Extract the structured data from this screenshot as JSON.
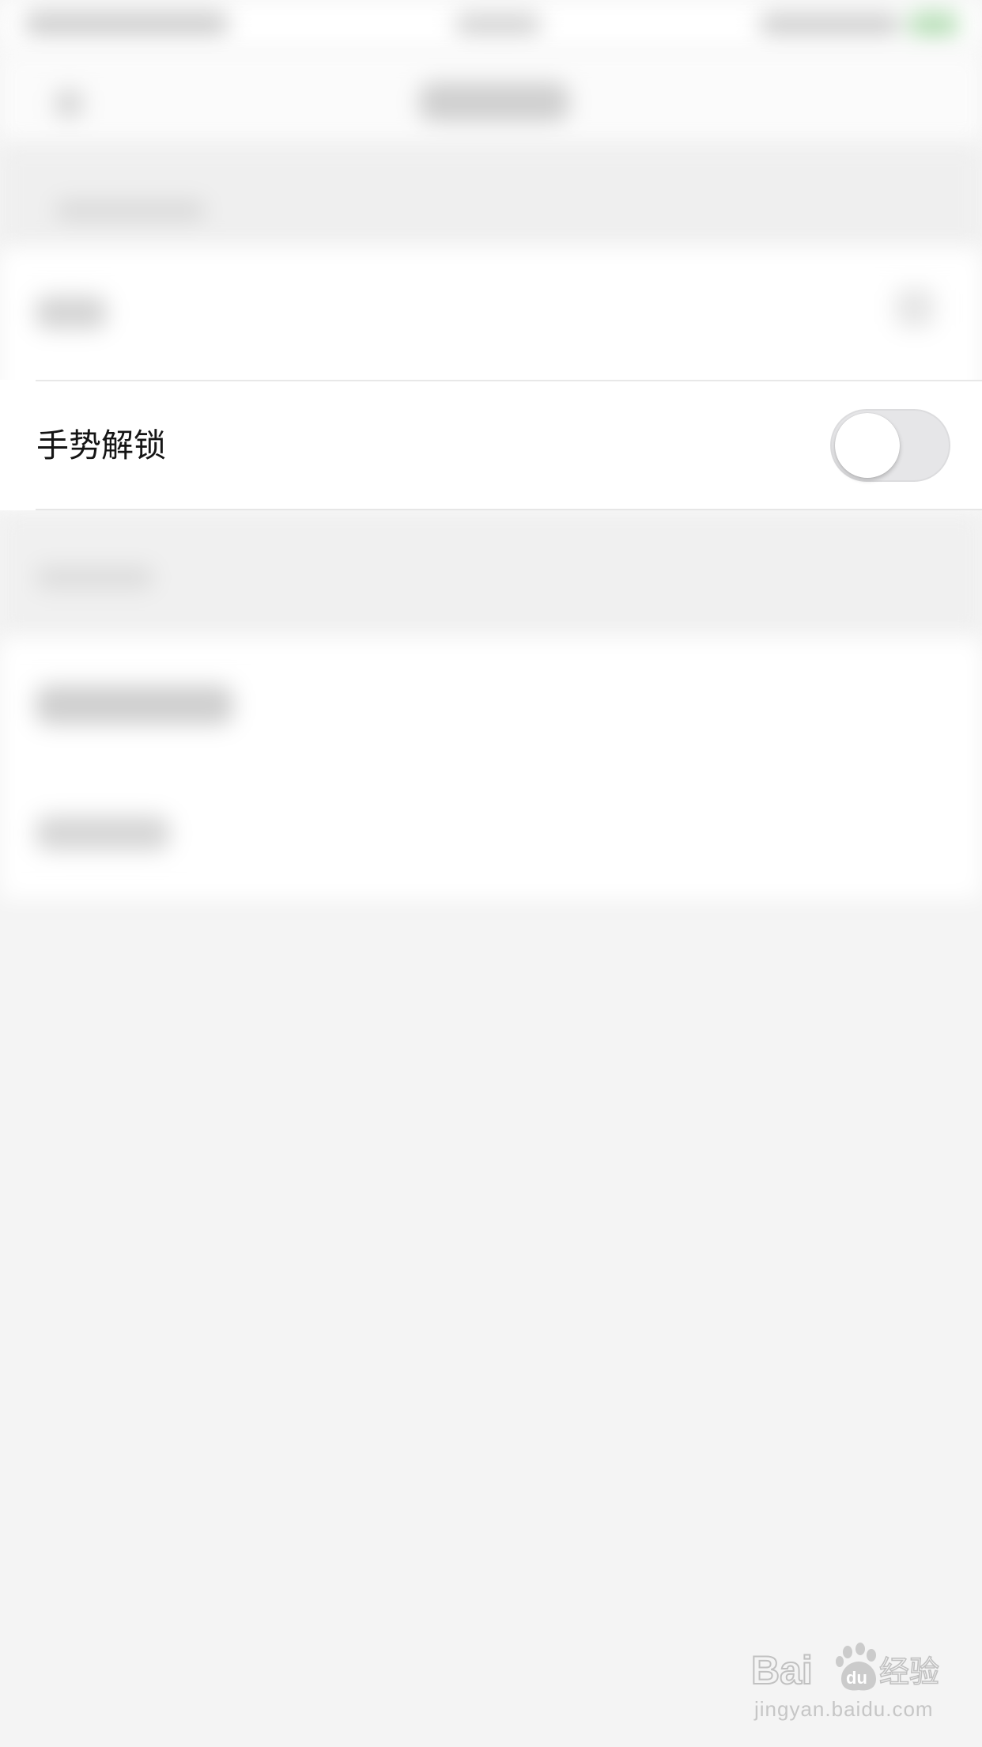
{
  "settings": {
    "gesture_unlock": {
      "label": "手势解锁",
      "enabled": false
    }
  },
  "watermark": {
    "brand": "Baidu经验",
    "brand_text_left": "Bai",
    "brand_text_mid": "du",
    "brand_text_right": "经验",
    "domain": "jingyan.baidu.com"
  },
  "colors": {
    "background": "#f4f4f4",
    "row_background": "#ffffff",
    "toggle_off": "#e6e6e8",
    "status_battery": "#b9dfb9"
  }
}
